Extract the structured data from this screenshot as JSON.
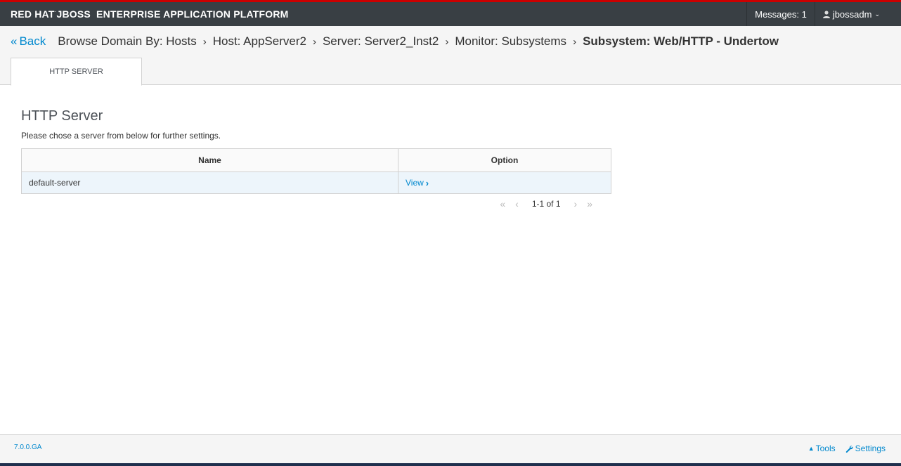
{
  "header": {
    "brand_primary": "RED HAT",
    "brand_secondary": "JBOSS",
    "brand_rest": "ENTERPRISE APPLICATION PLATFORM",
    "messages": "Messages: 1",
    "user": "jbossadm",
    "colors": {
      "bar": "#393f44",
      "accent": "#cc0000"
    }
  },
  "breadcrumb": {
    "back": "Back",
    "items": [
      "Browse Domain By: Hosts",
      "Host: AppServer2",
      "Server: Server2_Inst2",
      "Monitor: Subsystems"
    ],
    "current": "Subsystem: Web/HTTP - Undertow"
  },
  "tabs": [
    {
      "label": "HTTP SERVER",
      "active": true
    }
  ],
  "main": {
    "title": "HTTP Server",
    "description": "Please chose a server from below for further settings.",
    "table": {
      "columns": [
        "Name",
        "Option"
      ],
      "rows": [
        {
          "name": "default-server",
          "option": "View"
        }
      ]
    },
    "pager": {
      "info": "1-1 of 1"
    }
  },
  "footer": {
    "version": "7.0.0.GA",
    "tools": "Tools",
    "settings": "Settings"
  }
}
